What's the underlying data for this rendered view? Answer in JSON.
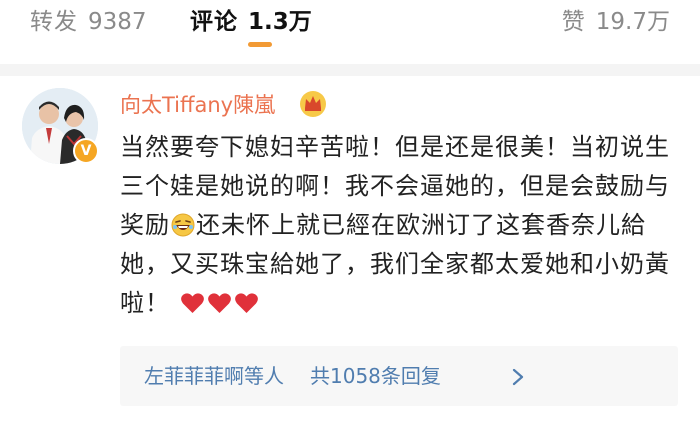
{
  "tabs": {
    "repost": {
      "label": "转发",
      "count": "9387"
    },
    "comment": {
      "label": "评论",
      "count": "1.3万"
    },
    "like": {
      "label": "赞",
      "count": "19.7万"
    }
  },
  "comment": {
    "username": "向太Tiffany陳嵐",
    "text_part1": "当然要夸下媳妇辛苦啦！但是还是很美！当初说生三个娃是她说的啊！我不会逼她的，但是会鼓励与奖励",
    "text_part2": "还未怀上就已經在欧洲订了这套香奈儿給她，又买珠宝給她了，我们全家都太爱她和小奶黃啦！",
    "verified_badge": "V",
    "emoji": "laughing-face-icon",
    "hearts": 3,
    "accent_color": "#eb7350",
    "link_color": "#507daf"
  },
  "replies": {
    "users": "左菲菲菲啊等人",
    "total": "共1058条回复"
  }
}
